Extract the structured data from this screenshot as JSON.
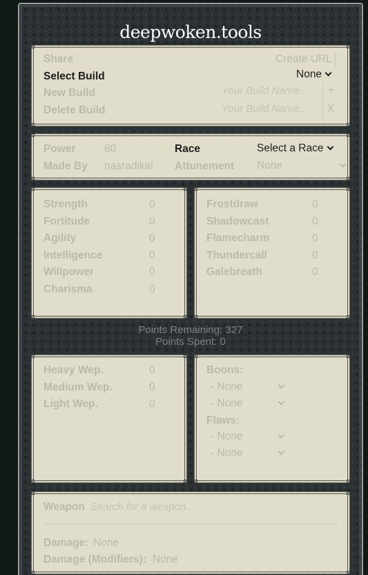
{
  "app": {
    "title": "deepwoken.tools"
  },
  "build": {
    "share_label": "Share",
    "create_url_label": "Create URL",
    "select_build_label": "Select Build",
    "select_build_value": "None",
    "new_build_label": "New Build",
    "new_build_placeholder": "Your Build Name...",
    "new_build_button": "+",
    "delete_build_label": "Delete Build",
    "delete_build_placeholder": "Your Build Name...",
    "delete_build_button": "X"
  },
  "info": {
    "power_label": "Power",
    "power_value": "60",
    "made_by_label": "Made By",
    "made_by_value": "nasradikal",
    "race_label": "Race",
    "race_value": "Select a Race",
    "attunement_label": "Attunement",
    "attunement_value": "None"
  },
  "attributes": [
    {
      "label": "Strength",
      "value": "0"
    },
    {
      "label": "Fortitude",
      "value": "0"
    },
    {
      "label": "Agility",
      "value": "0"
    },
    {
      "label": "Intelligence",
      "value": "0"
    },
    {
      "label": "Willpower",
      "value": "0"
    },
    {
      "label": "Charisma",
      "value": "0"
    }
  ],
  "attunements": [
    {
      "label": "Frostdraw",
      "value": "0"
    },
    {
      "label": "Shadowcast",
      "value": "0"
    },
    {
      "label": "Flamecharm",
      "value": "0"
    },
    {
      "label": "Thundercall",
      "value": "0"
    },
    {
      "label": "Galebreath",
      "value": "0"
    }
  ],
  "points": {
    "remaining": "Points Remaining: 327",
    "spent": "Points Spent: 0"
  },
  "weapons": [
    {
      "label": "Heavy Wep.",
      "value": "0"
    },
    {
      "label": "Medium Wep.",
      "value": "0"
    },
    {
      "label": "Light Wep.",
      "value": "0"
    }
  ],
  "traits": {
    "boons_label": "Boons:",
    "boons": [
      "- None",
      "- None"
    ],
    "flaws_label": "Flaws:",
    "flaws": [
      "- None",
      "- None"
    ]
  },
  "weapon": {
    "label": "Weapon",
    "placeholder": "Search for a weapon...",
    "damage_label": "Damage:",
    "damage_value": "None",
    "damage_mod_label": "Damage (Modifiers):",
    "damage_mod_value": "None"
  }
}
